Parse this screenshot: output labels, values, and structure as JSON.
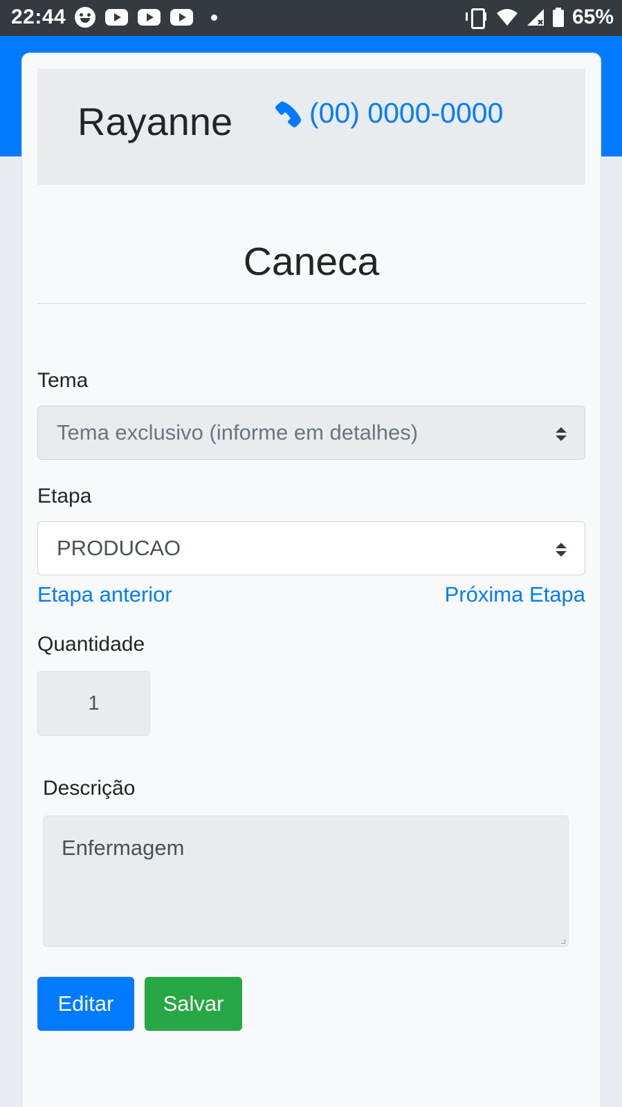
{
  "status_bar": {
    "time": "22:44",
    "battery": "65%",
    "icons": [
      "face-icon",
      "youtube-icon",
      "youtube-icon",
      "youtube-icon",
      "dot-icon",
      "vibrate-icon",
      "wifi-icon",
      "signal-icon",
      "battery-icon"
    ]
  },
  "header": {
    "customer_name": "Rayanne",
    "phone": "(00) 0000-0000",
    "phone_icon": "phone-icon"
  },
  "product": {
    "title": "Caneca"
  },
  "form": {
    "tema_label": "Tema",
    "tema_value": "Tema exclusivo (informe em detalhes)",
    "etapa_label": "Etapa",
    "etapa_value": "PRODUCAO",
    "prev_stage": "Etapa anterior",
    "next_stage": "Próxima Etapa",
    "quantidade_label": "Quantidade",
    "quantidade_value": "1",
    "descricao_label": "Descrição",
    "descricao_value": "Enfermagem"
  },
  "actions": {
    "edit_label": "Editar",
    "save_label": "Salvar"
  },
  "colors": {
    "primary": "#007bff",
    "success": "#28a745",
    "status_bar": "#343a40"
  }
}
